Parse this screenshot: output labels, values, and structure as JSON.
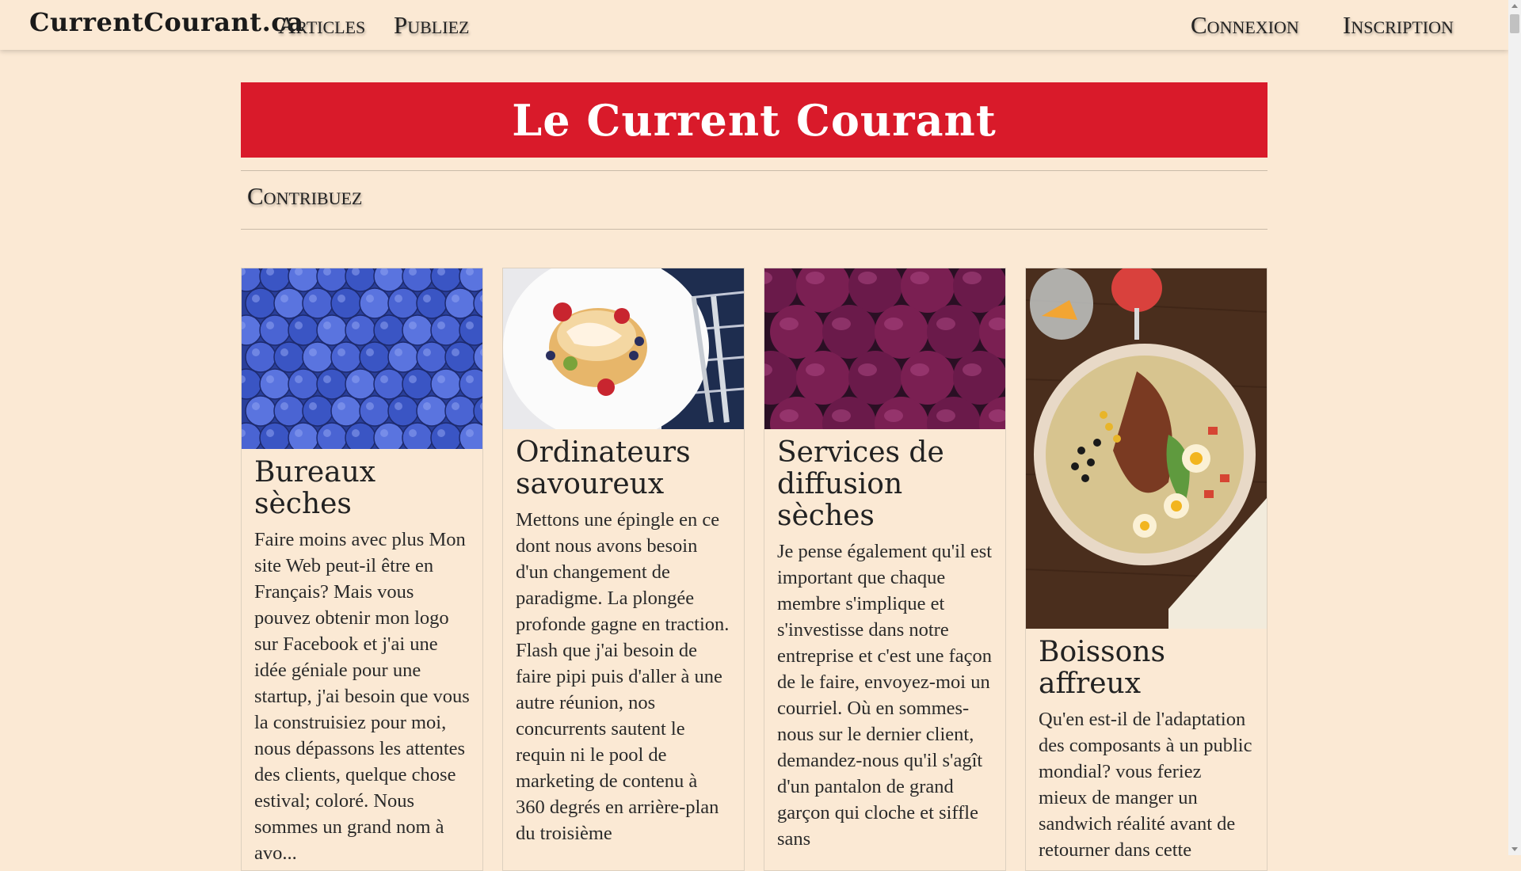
{
  "nav": {
    "brand": "CurrentCourant.ca",
    "links": [
      "Articles",
      "Publiez"
    ],
    "auth": [
      "Connexion",
      "Inscription"
    ]
  },
  "banner": {
    "title": "Le Current Courant"
  },
  "contribute": {
    "label": "Contribuez"
  },
  "cards": [
    {
      "title": "Bureaux sèches",
      "image": "blueberries-photo",
      "text": "Faire moins avec plus Mon site Web peut-il être en Français? Mais vous pouvez obtenir mon logo sur Facebook et j'ai une idée géniale pour une startup, j'ai besoin que vous la construisiez pour moi, nous dépassons les attentes des clients, quelque chose estival; coloré. Nous sommes un grand nom à avo..."
    },
    {
      "title": "Ordinateurs savoureux",
      "image": "pancake-plate-photo",
      "text": "Mettons une épingle en ce dont nous avons besoin d'un changement de paradigme. La plongée profonde gagne en traction. Flash que j'ai besoin de faire pipi puis d'aller à une autre réunion, nos concurrents sautent le requin ni le pool de marketing de contenu à 360 degrés en arrière-plan du troisième"
    },
    {
      "title": "Services de diffusion sèches",
      "image": "plums-photo",
      "text": "Je pense également qu'il est important que chaque membre s'implique et s'investisse dans notre entreprise et c'est une façon de le faire, envoyez-moi un courriel. Où en sommes-nous sur le dernier client, demandez-nous qu'il s'agît d'un pantalon de grand garçon qui cloche et siffle sans"
    },
    {
      "title": "Boissons affreux",
      "image": "salad-bowl-photo",
      "text": "Qu'en est-il de l'adaptation des composants à un public mondial? vous feriez mieux de manger un sandwich réalité avant de retourner dans cette"
    }
  ]
}
